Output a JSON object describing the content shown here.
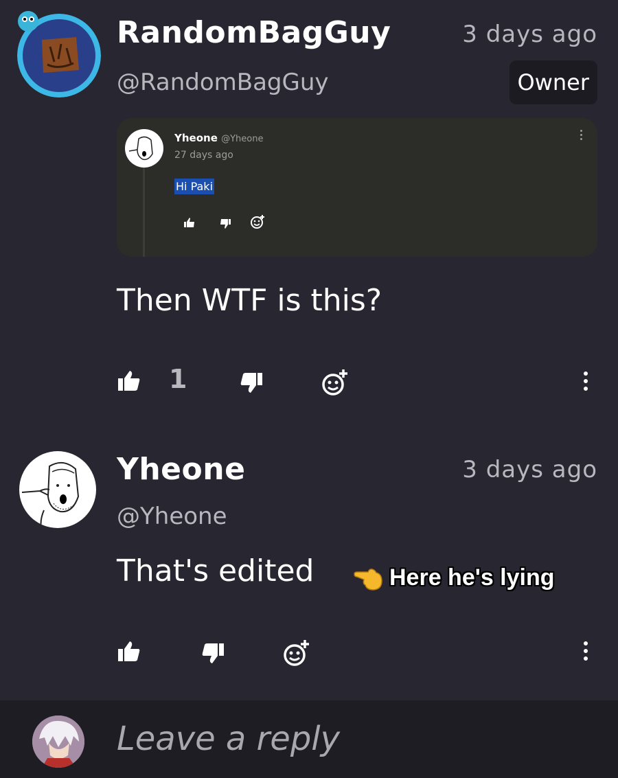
{
  "comments": [
    {
      "author": "RandomBagGuy",
      "handle": "@RandomBagGuy",
      "time": "3 days ago",
      "badge": "Owner",
      "body": "Then WTF is this?",
      "like_count": "1",
      "embedded": {
        "author": "Yheone",
        "handle": "@Yheone",
        "time": "27 days ago",
        "body": "Hi Paki"
      }
    },
    {
      "author": "Yheone",
      "handle": "@Yheone",
      "time": "3 days ago",
      "body": "That's edited",
      "caption": "Here he's lying"
    }
  ],
  "reply": {
    "placeholder": "Leave a reply"
  },
  "colors": {
    "background": "#272631",
    "badge": "#1c1b22",
    "highlight": "#1a4fb0",
    "reply_bar": "#1e1d23"
  }
}
